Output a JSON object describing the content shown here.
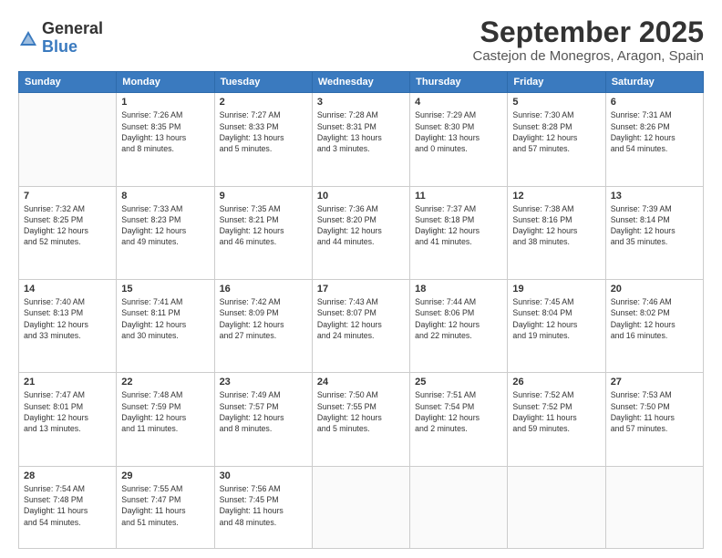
{
  "logo": {
    "general": "General",
    "blue": "Blue"
  },
  "title": "September 2025",
  "location": "Castejon de Monegros, Aragon, Spain",
  "days_of_week": [
    "Sunday",
    "Monday",
    "Tuesday",
    "Wednesday",
    "Thursday",
    "Friday",
    "Saturday"
  ],
  "weeks": [
    [
      {
        "day": "",
        "info": ""
      },
      {
        "day": "1",
        "info": "Sunrise: 7:26 AM\nSunset: 8:35 PM\nDaylight: 13 hours\nand 8 minutes."
      },
      {
        "day": "2",
        "info": "Sunrise: 7:27 AM\nSunset: 8:33 PM\nDaylight: 13 hours\nand 5 minutes."
      },
      {
        "day": "3",
        "info": "Sunrise: 7:28 AM\nSunset: 8:31 PM\nDaylight: 13 hours\nand 3 minutes."
      },
      {
        "day": "4",
        "info": "Sunrise: 7:29 AM\nSunset: 8:30 PM\nDaylight: 13 hours\nand 0 minutes."
      },
      {
        "day": "5",
        "info": "Sunrise: 7:30 AM\nSunset: 8:28 PM\nDaylight: 12 hours\nand 57 minutes."
      },
      {
        "day": "6",
        "info": "Sunrise: 7:31 AM\nSunset: 8:26 PM\nDaylight: 12 hours\nand 54 minutes."
      }
    ],
    [
      {
        "day": "7",
        "info": "Sunrise: 7:32 AM\nSunset: 8:25 PM\nDaylight: 12 hours\nand 52 minutes."
      },
      {
        "day": "8",
        "info": "Sunrise: 7:33 AM\nSunset: 8:23 PM\nDaylight: 12 hours\nand 49 minutes."
      },
      {
        "day": "9",
        "info": "Sunrise: 7:35 AM\nSunset: 8:21 PM\nDaylight: 12 hours\nand 46 minutes."
      },
      {
        "day": "10",
        "info": "Sunrise: 7:36 AM\nSunset: 8:20 PM\nDaylight: 12 hours\nand 44 minutes."
      },
      {
        "day": "11",
        "info": "Sunrise: 7:37 AM\nSunset: 8:18 PM\nDaylight: 12 hours\nand 41 minutes."
      },
      {
        "day": "12",
        "info": "Sunrise: 7:38 AM\nSunset: 8:16 PM\nDaylight: 12 hours\nand 38 minutes."
      },
      {
        "day": "13",
        "info": "Sunrise: 7:39 AM\nSunset: 8:14 PM\nDaylight: 12 hours\nand 35 minutes."
      }
    ],
    [
      {
        "day": "14",
        "info": "Sunrise: 7:40 AM\nSunset: 8:13 PM\nDaylight: 12 hours\nand 33 minutes."
      },
      {
        "day": "15",
        "info": "Sunrise: 7:41 AM\nSunset: 8:11 PM\nDaylight: 12 hours\nand 30 minutes."
      },
      {
        "day": "16",
        "info": "Sunrise: 7:42 AM\nSunset: 8:09 PM\nDaylight: 12 hours\nand 27 minutes."
      },
      {
        "day": "17",
        "info": "Sunrise: 7:43 AM\nSunset: 8:07 PM\nDaylight: 12 hours\nand 24 minutes."
      },
      {
        "day": "18",
        "info": "Sunrise: 7:44 AM\nSunset: 8:06 PM\nDaylight: 12 hours\nand 22 minutes."
      },
      {
        "day": "19",
        "info": "Sunrise: 7:45 AM\nSunset: 8:04 PM\nDaylight: 12 hours\nand 19 minutes."
      },
      {
        "day": "20",
        "info": "Sunrise: 7:46 AM\nSunset: 8:02 PM\nDaylight: 12 hours\nand 16 minutes."
      }
    ],
    [
      {
        "day": "21",
        "info": "Sunrise: 7:47 AM\nSunset: 8:01 PM\nDaylight: 12 hours\nand 13 minutes."
      },
      {
        "day": "22",
        "info": "Sunrise: 7:48 AM\nSunset: 7:59 PM\nDaylight: 12 hours\nand 11 minutes."
      },
      {
        "day": "23",
        "info": "Sunrise: 7:49 AM\nSunset: 7:57 PM\nDaylight: 12 hours\nand 8 minutes."
      },
      {
        "day": "24",
        "info": "Sunrise: 7:50 AM\nSunset: 7:55 PM\nDaylight: 12 hours\nand 5 minutes."
      },
      {
        "day": "25",
        "info": "Sunrise: 7:51 AM\nSunset: 7:54 PM\nDaylight: 12 hours\nand 2 minutes."
      },
      {
        "day": "26",
        "info": "Sunrise: 7:52 AM\nSunset: 7:52 PM\nDaylight: 11 hours\nand 59 minutes."
      },
      {
        "day": "27",
        "info": "Sunrise: 7:53 AM\nSunset: 7:50 PM\nDaylight: 11 hours\nand 57 minutes."
      }
    ],
    [
      {
        "day": "28",
        "info": "Sunrise: 7:54 AM\nSunset: 7:48 PM\nDaylight: 11 hours\nand 54 minutes."
      },
      {
        "day": "29",
        "info": "Sunrise: 7:55 AM\nSunset: 7:47 PM\nDaylight: 11 hours\nand 51 minutes."
      },
      {
        "day": "30",
        "info": "Sunrise: 7:56 AM\nSunset: 7:45 PM\nDaylight: 11 hours\nand 48 minutes."
      },
      {
        "day": "",
        "info": ""
      },
      {
        "day": "",
        "info": ""
      },
      {
        "day": "",
        "info": ""
      },
      {
        "day": "",
        "info": ""
      }
    ]
  ]
}
